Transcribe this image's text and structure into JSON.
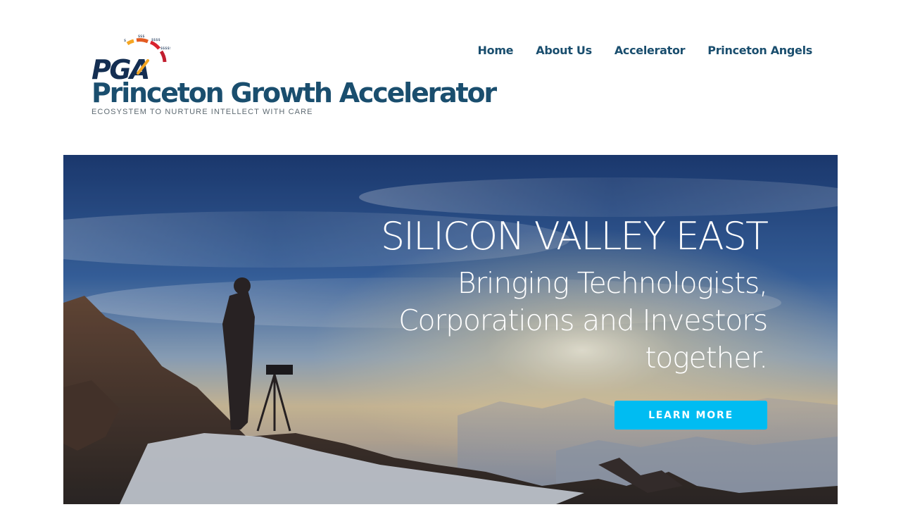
{
  "brand": {
    "logo_text": "PGA",
    "logo_gauge_labels": [
      "$",
      "$$$",
      "$$$$",
      "$$$$$"
    ],
    "title": "Princeton Growth Accelerator",
    "tagline": "ECOSYSTEM TO NURTURE INTELLECT WITH CARE"
  },
  "nav": {
    "items": [
      "Home",
      "About Us",
      "Accelerator",
      "Princeton Angels"
    ]
  },
  "hero": {
    "title": "SILICON VALLEY EAST",
    "subtitle_lines": [
      "Bringing Technologists,",
      "Corporations and Investors",
      "together."
    ],
    "cta_label": "LEARN MORE",
    "image_subject": "photographer-with-tripod-on-mountain-at-sunrise"
  },
  "colors": {
    "brand_navy": "#1a4e6e",
    "logo_navy": "#142e52",
    "gauge_orange": "#f5a623",
    "gauge_red": "#d9232e",
    "cta_blue": "#00bcf2",
    "tagline_gray": "#5e6a72"
  }
}
